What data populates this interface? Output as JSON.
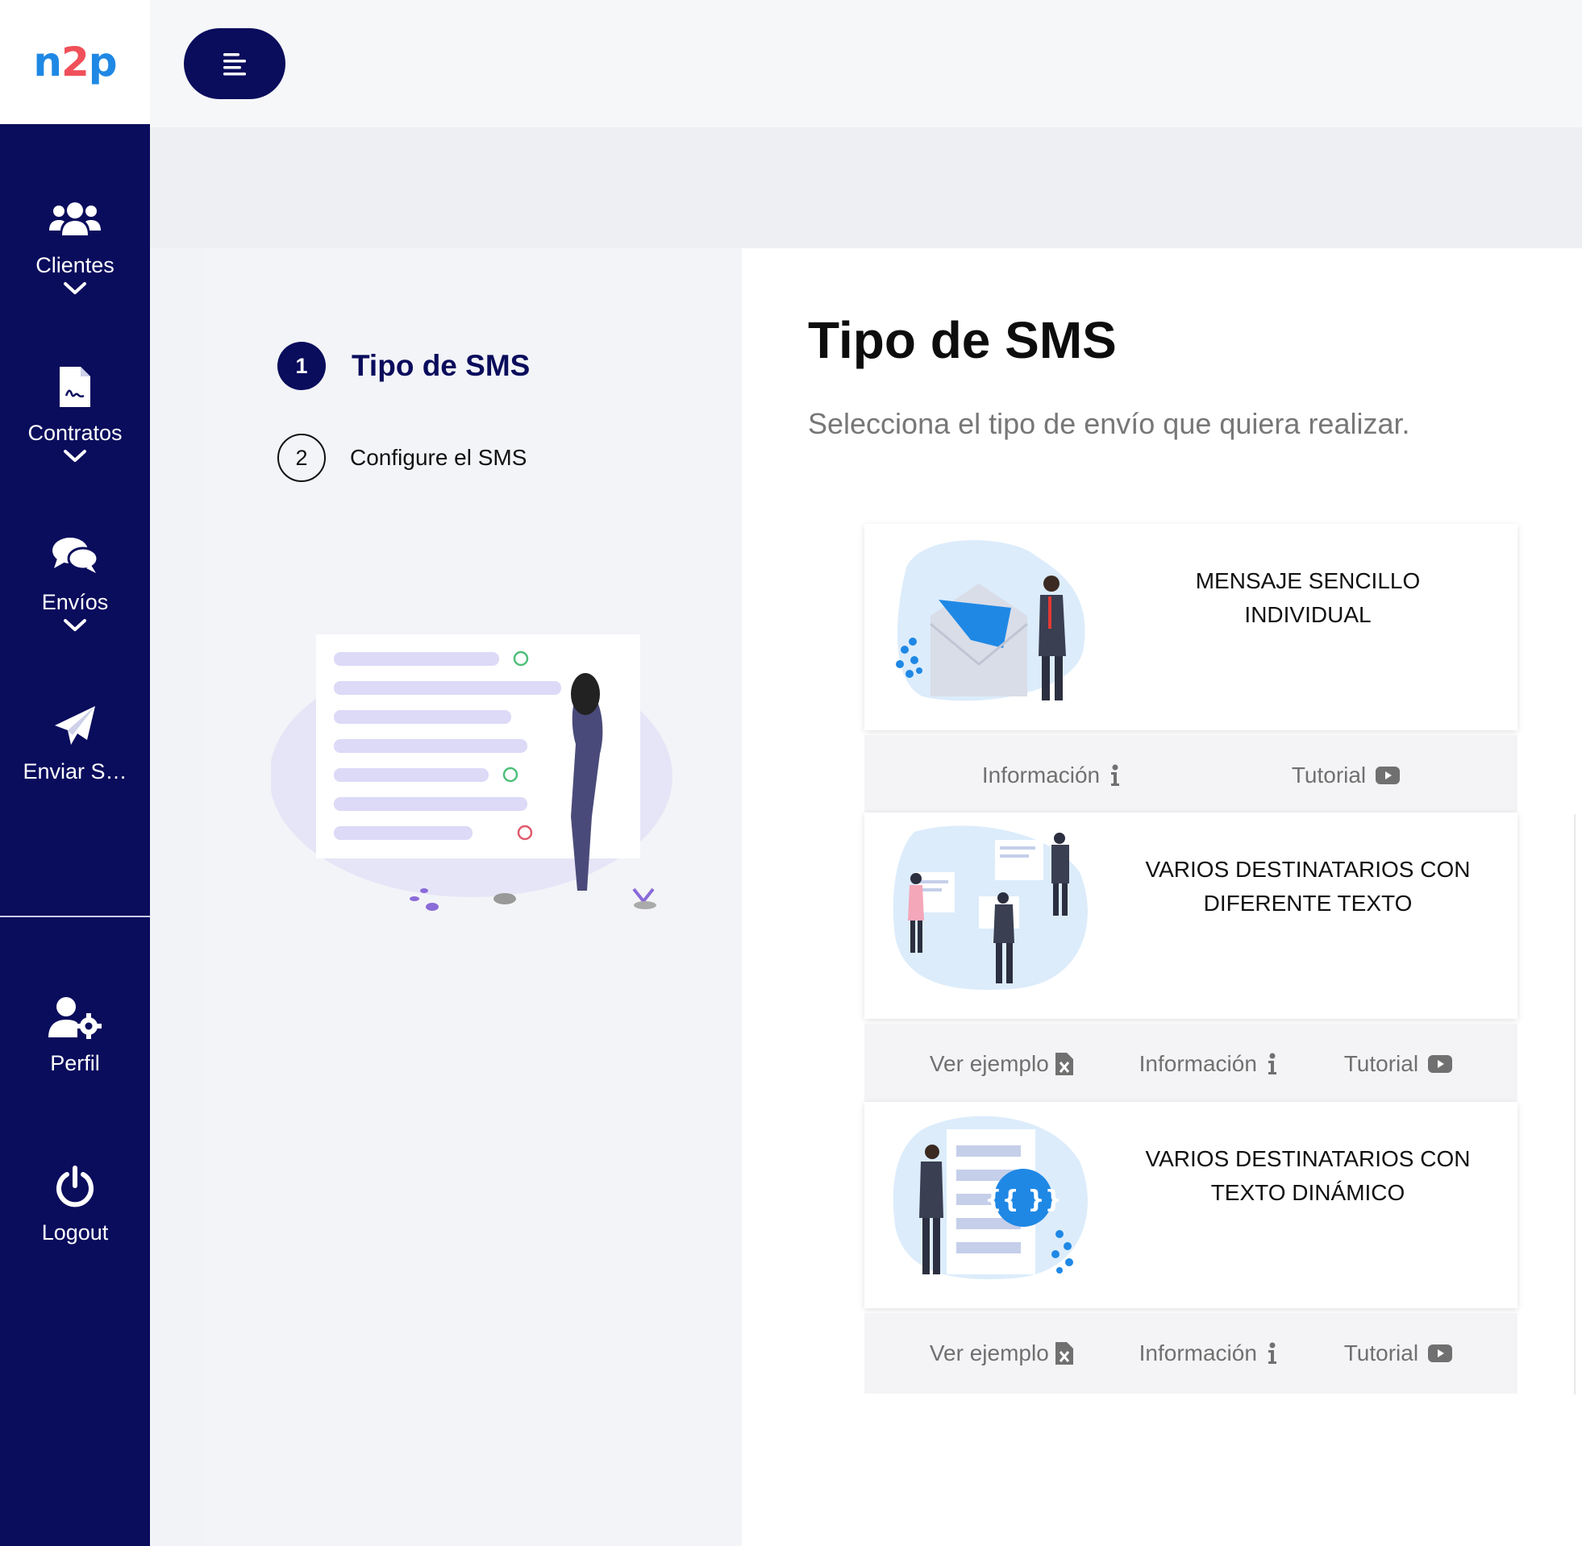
{
  "app": {
    "logo_part1": "n",
    "logo_part2": "2",
    "logo_part3": "p"
  },
  "sidebar": {
    "items": [
      {
        "label": "Clientes",
        "icon": "users-icon",
        "expandable": true
      },
      {
        "label": "Contratos",
        "icon": "contract-file-icon",
        "expandable": true
      },
      {
        "label": "Envíos",
        "icon": "chat-bubbles-icon",
        "expandable": true
      },
      {
        "label": "Enviar S…",
        "icon": "paper-plane-icon",
        "expandable": false
      }
    ],
    "bottom": [
      {
        "label": "Perfil",
        "icon": "user-gear-icon"
      },
      {
        "label": "Logout",
        "icon": "power-icon"
      }
    ]
  },
  "wizard": {
    "steps": [
      {
        "number": "1",
        "label": "Tipo de SMS",
        "active": true
      },
      {
        "number": "2",
        "label": "Configure el SMS",
        "active": false
      }
    ]
  },
  "main": {
    "title": "Tipo de SMS",
    "subtitle": "Selecciona el tipo de envío que quiera realizar.",
    "cards": [
      {
        "title_line1": "MENSAJE SENCILLO",
        "title_line2": "INDIVIDUAL",
        "actions": {
          "info": "Información",
          "tutorial": "Tutorial"
        }
      },
      {
        "title_line1": "VARIOS DESTINATARIOS CON",
        "title_line2": "DIFERENTE TEXTO",
        "actions": {
          "example": "Ver ejemplo",
          "info": "Información",
          "tutorial": "Tutorial"
        }
      },
      {
        "title_line1": "VARIOS DESTINATARIOS CON",
        "title_line2": "TEXTO DINÁMICO",
        "actions": {
          "example": "Ver ejemplo",
          "info": "Información",
          "tutorial": "Tutorial"
        }
      }
    ]
  },
  "colors": {
    "sidebar": "#0a0c5c",
    "accent_blue": "#1f88e5",
    "accent_red": "#f0505a"
  }
}
